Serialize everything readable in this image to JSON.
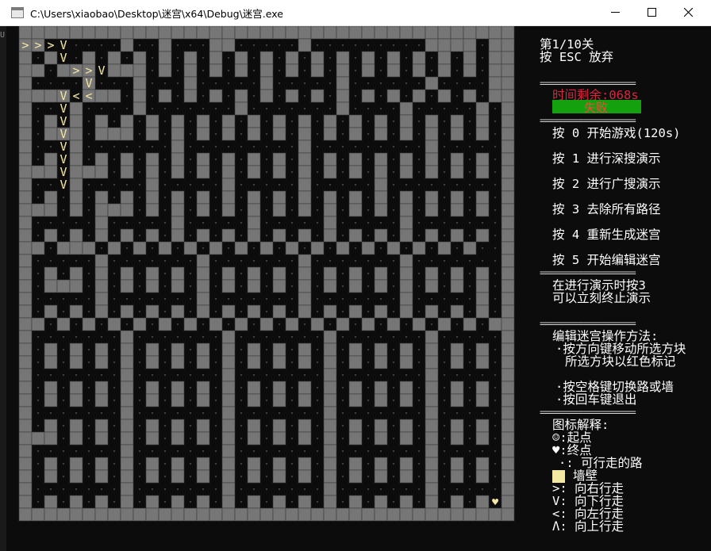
{
  "window": {
    "title": "C:\\Users\\xiaobao\\Desktop\\迷宫\\x64\\Debug\\迷宫.exe",
    "minimize_icon": "minimize-icon",
    "maximize_icon": "maximize-icon",
    "close_icon": "close-icon"
  },
  "colors": {
    "background": "#0c0c0c",
    "wall": "#767676",
    "wall_border": "#3a3a3a",
    "path_dot": "#6a6a6a",
    "arrow": "#f3e7a4",
    "timer": "#d7263d",
    "status_bg": "#13a10e",
    "status_text": "#ff4040",
    "end_marker": "#f3e7a4"
  },
  "panel": {
    "level": "第1/10关",
    "give_up": "按 ESC 放弃",
    "separator": "====================",
    "timer": "时间剩余:068s",
    "status": "失败",
    "menu": [
      "按 0 开始游戏(120s)",
      "按 1 进行深搜演示",
      "按 2 进行广搜演示",
      "按 3 去除所有路径",
      "按 4 重新生成迷宫",
      "按 5 开始编辑迷宫"
    ],
    "demo_note_1": "在进行演示时按3",
    "demo_note_2": "可以立刻终止演示",
    "edit_title": "编辑迷宫操作方法:",
    "edit_1a": "·按方向键移动所选方块",
    "edit_1b": "所选方块以红色标记",
    "edit_2": "·按空格键切换路或墙",
    "edit_3": "·按回车键退出",
    "legend_title": "图标解释:",
    "legend": [
      {
        "symbol": "☺:",
        "label": "起点"
      },
      {
        "symbol": "♥:",
        "label": "终点"
      },
      {
        "symbol": "·:",
        "label": "可行走的路"
      },
      {
        "symbol": "",
        "label": "墙壁"
      },
      {
        "symbol": ">:",
        "label": "向右行走"
      },
      {
        "symbol": "V:",
        "label": "向下行走"
      },
      {
        "symbol": "<:",
        "label": "向左行走"
      },
      {
        "symbol": "Λ:",
        "label": "向上行走"
      }
    ]
  },
  "maze": {
    "cols": 39,
    "rows": 39,
    "wall_indices": [
      0,
      1,
      2,
      3,
      4,
      5,
      6,
      7,
      8,
      9,
      10,
      11,
      12,
      13,
      14,
      15,
      16,
      17,
      18,
      19,
      20,
      21,
      22,
      23,
      24,
      25,
      26,
      27,
      28,
      29,
      30,
      31,
      32,
      33,
      34,
      35,
      36,
      37,
      38,
      40,
      47,
      50,
      54,
      55,
      61,
      71,
      72,
      73,
      74,
      76,
      77,
      78,
      80,
      83,
      85,
      87,
      89,
      91,
      93,
      95,
      97,
      99,
      101,
      103,
      105,
      107,
      109,
      111,
      113,
      115,
      117,
      118,
      120,
      121,
      122,
      124,
      125,
      126,
      128,
      130,
      132,
      134,
      136,
      138,
      140,
      142,
      144,
      146,
      148,
      150,
      152,
      154,
      156,
      161,
      165,
      169,
      175,
      181,
      188,
      193,
      195,
      196,
      197,
      198,
      200,
      201,
      202,
      204,
      206,
      208,
      210,
      212,
      214,
      216,
      218,
      220,
      222,
      224,
      226,
      228,
      230,
      232,
      234,
      238,
      243,
      251,
      259,
      264,
      270,
      273,
      275,
      277,
      279,
      281,
      283,
      285,
      287,
      289,
      291,
      293,
      295,
      297,
      299,
      301,
      303,
      305,
      307,
      309,
      312,
      314,
      315,
      316,
      318,
      319,
      320,
      322,
      324,
      326,
      328,
      330,
      332,
      334,
      336,
      338,
      340,
      342,
      344,
      346,
      348,
      351,
      355,
      363,
      373,
      383,
      390,
      392,
      394,
      396,
      398,
      400,
      402,
      404,
      406,
      408,
      410,
      412,
      414,
      416,
      418,
      420,
      422,
      424,
      426,
      429,
      430,
      431,
      433,
      434,
      435,
      437,
      439,
      441,
      443,
      445,
      447,
      449,
      451,
      453,
      455,
      457,
      459,
      461,
      463,
      465,
      468,
      472,
      478,
      484,
      490,
      496,
      507,
      509,
      511,
      513,
      515,
      517,
      519,
      521,
      523,
      525,
      527,
      529,
      531,
      533,
      535,
      537,
      539,
      541,
      543,
      546,
      547,
      548,
      550,
      552,
      553,
      554,
      556,
      558,
      560,
      562,
      564,
      566,
      568,
      570,
      572,
      574,
      576,
      578,
      580,
      582,
      585,
      591,
      597,
      603,
      609,
      615,
      624,
      626,
      628,
      630,
      632,
      634,
      636,
      638,
      640,
      642,
      644,
      646,
      648,
      650,
      652,
      654,
      656,
      658,
      660,
      663,
      664,
      666,
      667,
      668,
      670,
      672,
      674,
      676,
      678,
      680,
      682,
      684,
      686,
      688,
      690,
      692,
      694,
      696,
      698,
      702,
      708,
      716,
      724,
      732,
      740,
      741,
      743,
      745,
      747,
      749,
      751,
      753,
      755,
      757,
      759,
      761,
      763,
      765,
      767,
      769,
      771,
      773,
      775,
      777,
      780,
      782,
      783,
      784,
      786,
      788,
      790,
      792,
      794,
      796,
      798,
      800,
      802,
      804,
      806,
      808,
      810,
      812,
      814,
      816,
      819,
      825,
      833,
      841,
      849,
      855,
      858,
      860,
      862,
      864,
      866,
      868,
      870,
      872,
      874,
      876,
      878,
      880,
      882,
      884,
      886,
      888,
      890,
      892,
      894,
      897,
      898,
      900,
      902,
      904,
      906,
      908,
      910,
      912,
      914,
      916,
      918,
      920,
      922,
      924,
      926,
      928,
      930,
      932,
      934,
      936,
      944,
      952,
      960,
      968,
      975,
      977,
      979,
      981,
      983,
      985,
      987,
      989,
      991,
      993,
      995,
      997,
      999,
      1001,
      1003,
      1005,
      1007,
      1009,
      1011,
      1014,
      1016,
      1018,
      1020,
      1022,
      1024,
      1026,
      1028,
      1030,
      1032,
      1034,
      1036,
      1038,
      1040,
      1042,
      1044,
      1046,
      1048,
      1050,
      1053,
      1061,
      1069,
      1077,
      1085,
      1092,
      1094,
      1096,
      1098,
      1100,
      1102,
      1104,
      1106,
      1108,
      1110,
      1112,
      1114,
      1116,
      1118,
      1120,
      1122,
      1124,
      1126,
      1128,
      1131,
      1133,
      1135,
      1137,
      1139,
      1141,
      1143,
      1145,
      1147,
      1149,
      1151,
      1153,
      1155,
      1157,
      1159,
      1161,
      1163,
      1165,
      1167,
      1170,
      1178,
      1186,
      1194,
      1202,
      1209,
      1211,
      1213,
      1215,
      1217,
      1219,
      1221,
      1223,
      1225,
      1227,
      1229,
      1231,
      1233,
      1235,
      1237,
      1239,
      1241,
      1243,
      1245,
      1248,
      1249,
      1250,
      1252,
      1254,
      1256,
      1258,
      1260,
      1262,
      1264,
      1266,
      1268,
      1270,
      1272,
      1274,
      1276,
      1278,
      1280,
      1282,
      1284,
      1287,
      1295,
      1303,
      1311,
      1319,
      1326,
      1328,
      1330,
      1332,
      1334,
      1336,
      1338,
      1340,
      1342,
      1344,
      1346,
      1348,
      1350,
      1352,
      1354,
      1356,
      1358,
      1360,
      1362,
      1365,
      1367,
      1369,
      1371,
      1373,
      1375,
      1377,
      1379,
      1381,
      1383,
      1385,
      1387,
      1389,
      1391,
      1393,
      1395,
      1397,
      1399,
      1401,
      1404,
      1412,
      1420,
      1428,
      1436,
      1443,
      1445,
      1447,
      1449,
      1451,
      1453,
      1455,
      1457,
      1459,
      1461,
      1463,
      1465,
      1467,
      1469,
      1471,
      1473,
      1475,
      1477,
      1479,
      1482,
      1483,
      1484,
      1485,
      1486,
      1487,
      1488,
      1489,
      1490,
      1491,
      1492,
      1493,
      1494,
      1495,
      1496,
      1497,
      1498,
      1499,
      1500,
      1501,
      1502,
      1503,
      1504,
      1505,
      1506,
      1507,
      1508,
      1509,
      1510,
      1511,
      1512,
      1513,
      1514,
      1515,
      1516,
      1517,
      1518,
      1519,
      1520
    ],
    "path_markers": [
      {
        "row": 1,
        "col": 0,
        "symbol": ">"
      },
      {
        "row": 1,
        "col": 1,
        "symbol": ">"
      },
      {
        "row": 1,
        "col": 2,
        "symbol": ">"
      },
      {
        "row": 1,
        "col": 3,
        "symbol": "V"
      },
      {
        "row": 2,
        "col": 3,
        "symbol": "V"
      },
      {
        "row": 3,
        "col": 4,
        "symbol": ">"
      },
      {
        "row": 3,
        "col": 5,
        "symbol": ">"
      },
      {
        "row": 3,
        "col": 6,
        "symbol": "V"
      },
      {
        "row": 4,
        "col": 5,
        "symbol": "V"
      },
      {
        "row": 5,
        "col": 3,
        "symbol": "V"
      },
      {
        "row": 5,
        "col": 4,
        "symbol": "<"
      },
      {
        "row": 5,
        "col": 5,
        "symbol": "<"
      },
      {
        "row": 6,
        "col": 3,
        "symbol": "V"
      },
      {
        "row": 7,
        "col": 3,
        "symbol": "V"
      },
      {
        "row": 8,
        "col": 3,
        "symbol": "V"
      },
      {
        "row": 9,
        "col": 3,
        "symbol": "V"
      },
      {
        "row": 10,
        "col": 3,
        "symbol": "V"
      },
      {
        "row": 11,
        "col": 3,
        "symbol": "V"
      },
      {
        "row": 12,
        "col": 3,
        "symbol": "V"
      }
    ],
    "end_marker": "♥"
  }
}
